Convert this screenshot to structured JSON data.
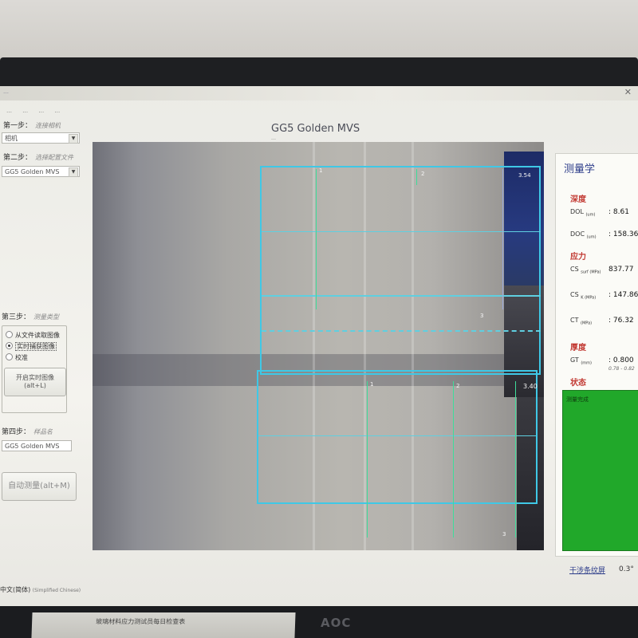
{
  "window": {
    "title": "…",
    "close": "✕"
  },
  "menu": [
    "…",
    "…",
    "…",
    "…"
  ],
  "app": {
    "name": "GG5 Golden MVS",
    "subtitle": "…"
  },
  "steps": {
    "step1": {
      "label": "第一步：",
      "hint": "连接相机"
    },
    "step1_select": "相机",
    "step2": {
      "label": "第二步：",
      "hint": "选择配置文件"
    },
    "step2_select": "GG5 Golden MVS",
    "step3": {
      "label": "第三步：",
      "hint": "测量类型"
    },
    "radios": [
      {
        "label": "从文件读取图像",
        "checked": false
      },
      {
        "label": "实时捕获图像",
        "checked": true
      },
      {
        "label": "校准",
        "checked": false
      }
    ],
    "live_button": {
      "line1": "开启实时图像",
      "line2": "(alt+L)"
    },
    "step4": {
      "label": "第四步：",
      "hint": "样品名"
    },
    "sample_name": "GG5 Golden MVS",
    "auto_measure": "自动测量(alt+M)"
  },
  "viewer": {
    "top_labels": [
      "1",
      "2",
      "3.54"
    ],
    "bottom_labels": [
      "1",
      "2",
      "3.40"
    ],
    "mid_label": "3",
    "bottom_corner": "3"
  },
  "metrology": {
    "title": "测量学",
    "depth": {
      "title": "深度",
      "rows": [
        {
          "name": "DOL",
          "unit": "(um)",
          "value": ": 8.61"
        },
        {
          "name": "DOC",
          "unit": "(um)",
          "value": ": 158.36"
        }
      ]
    },
    "stress": {
      "title": "应力",
      "rows": [
        {
          "name": "CS",
          "unit": "surf (MPa)",
          "value": "837.77"
        },
        {
          "name": "CS",
          "unit": "K (MPa)",
          "value": ": 147.86"
        },
        {
          "name": "CT",
          "unit": "(MPa)",
          "value": ": 76.32"
        }
      ]
    },
    "thickness": {
      "title": "厚度",
      "name": "GT",
      "unit": "(mm)",
      "value": ": 0.800",
      "range": "0.78 - 0.82"
    },
    "status": {
      "title": "状态",
      "text": "测量完成"
    },
    "status_color": "#21a82a"
  },
  "footer": {
    "fringe_link": "干涉条纹屏",
    "angle": "0.3°",
    "language": "中文(简体)",
    "language_en": "(Simplified Chinese)"
  },
  "desk": {
    "paper_title": "玻璃材料应力测试员每日检查表",
    "monitor_brand": "AOC"
  }
}
